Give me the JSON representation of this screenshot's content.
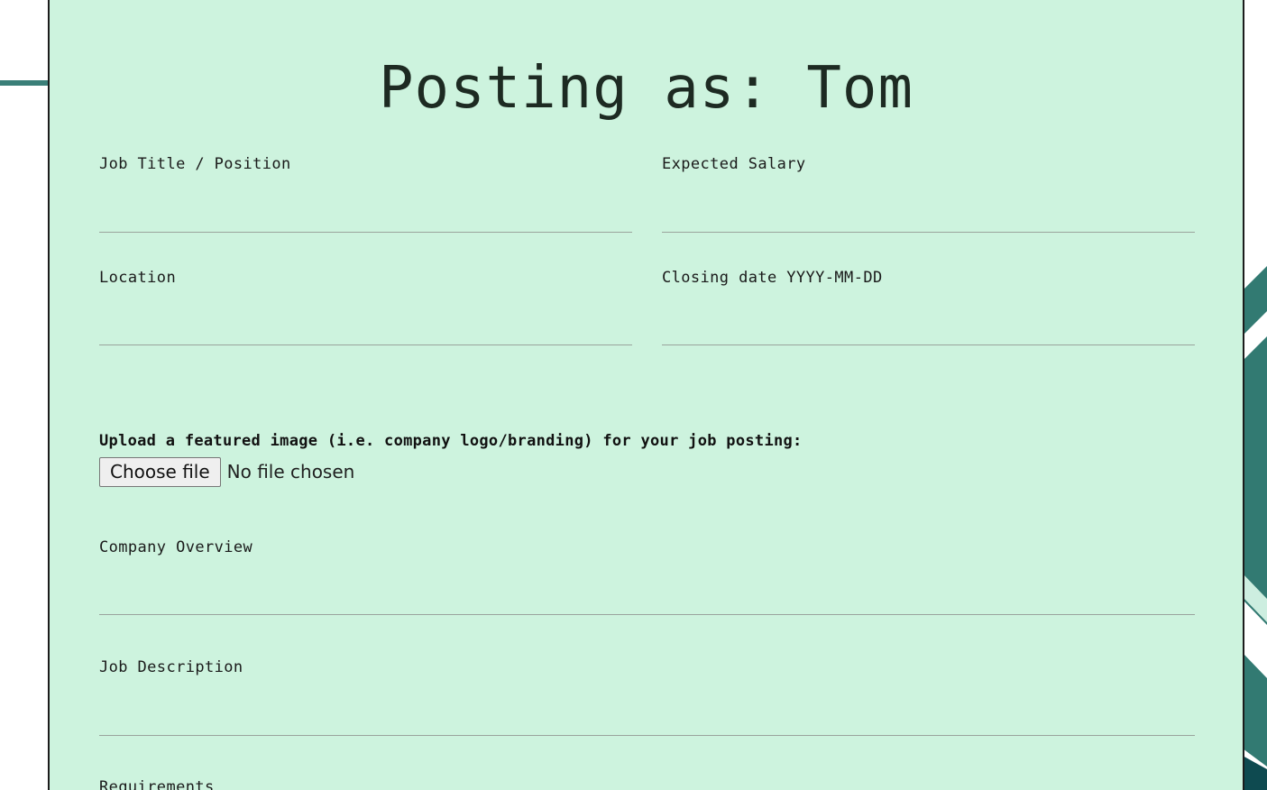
{
  "form": {
    "title": "Posting as: Tom",
    "fields": {
      "job_title": {
        "label": "Job Title / Position",
        "value": ""
      },
      "salary": {
        "label": "Expected Salary",
        "value": ""
      },
      "location": {
        "label": "Location",
        "value": ""
      },
      "closing_date": {
        "label": "Closing date YYYY-MM-DD",
        "value": ""
      },
      "company_overview": {
        "label": "Company Overview",
        "value": ""
      },
      "job_description": {
        "label": "Job Description",
        "value": ""
      },
      "requirements": {
        "label": "Requirements",
        "value": ""
      }
    },
    "upload": {
      "label": "Upload a featured image (i.e. company logo/branding) for your job posting:",
      "button_label": "Choose file",
      "status": "No file chosen"
    }
  },
  "colors": {
    "card_background": "#cdf3de",
    "decoration": "#2f7a72",
    "decoration_dark": "#0e4a50"
  }
}
